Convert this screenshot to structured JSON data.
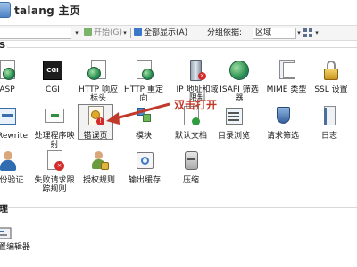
{
  "window": {
    "title": "talang 主页"
  },
  "toolbar": {
    "start_label": "开始(G)",
    "show_all_label": "全部显示(A)",
    "group_by_label": "分组依据:",
    "group_by_value": "区域"
  },
  "sections": {
    "first_label": "S",
    "second_label": "理"
  },
  "features": [
    {
      "name": "asp",
      "label": "ASP"
    },
    {
      "name": "cgi",
      "label": "CGI",
      "icon_text": "CGI"
    },
    {
      "name": "http-response-headers",
      "label": "HTTP 响应标头"
    },
    {
      "name": "http-redirect",
      "label": "HTTP 重定向"
    },
    {
      "name": "ip-domain-restrictions",
      "label": "IP 地址和域限制"
    },
    {
      "name": "isapi-filters",
      "label": "ISAPI 筛选器"
    },
    {
      "name": "mime-types",
      "label": "MIME 类型"
    },
    {
      "name": "ssl-settings",
      "label": "SSL 设置"
    },
    {
      "name": "url-rewrite",
      "label": "Rewrite"
    },
    {
      "name": "handler-mappings",
      "label": "处理程序映射"
    },
    {
      "name": "error-pages",
      "label": "错误页"
    },
    {
      "name": "modules",
      "label": "模块"
    },
    {
      "name": "default-document",
      "label": "默认文档"
    },
    {
      "name": "directory-browsing",
      "label": "目录浏览"
    },
    {
      "name": "request-filtering",
      "label": "请求筛选"
    },
    {
      "name": "logging",
      "label": "日志"
    },
    {
      "name": "authentication",
      "label": "份验证"
    },
    {
      "name": "failed-request-tracing",
      "label": "失败请求跟踪规则"
    },
    {
      "name": "authorization-rules",
      "label": "授权规则"
    },
    {
      "name": "output-caching",
      "label": "输出缓存"
    },
    {
      "name": "compression",
      "label": "压缩"
    }
  ],
  "annotation": {
    "text": "双击打开",
    "color": "#c0392b"
  },
  "lower": {
    "item_label": "置编辑器"
  },
  "colors": {
    "selection": "#f2f2f2",
    "annotation_red": "#c0392b"
  }
}
